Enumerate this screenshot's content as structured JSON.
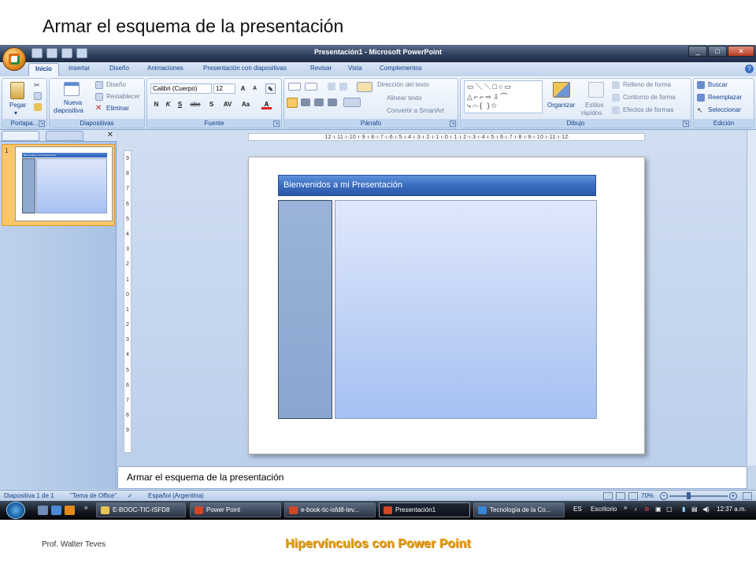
{
  "slide_heading": "Armar el esquema de la presentación",
  "window": {
    "title": "Presentación1 - Microsoft PowerPoint",
    "tabs": [
      "Inicio",
      "Insertar",
      "Diseño",
      "Animaciones",
      "Presentación con diapositivas",
      "Revisar",
      "Vista",
      "Complementos"
    ],
    "active_tab": "Inicio"
  },
  "ribbon": {
    "portapapeles": {
      "label": "Portapa...",
      "pegar": "Pegar"
    },
    "diapositivas": {
      "label": "Diapositivas",
      "nueva": "Nueva",
      "nueva2": "diapositiva",
      "diseno": "Diseño",
      "restablecer": "Restablecer",
      "eliminar": "Eliminar"
    },
    "fuente": {
      "label": "Fuente",
      "font": "Calibri (Cuerpo)",
      "size": "12"
    },
    "parrafo": {
      "label": "Párrafo",
      "direccion": "Dirección del texto",
      "alinear": "Alinear texto",
      "smartart": "Convertir a SmartArt"
    },
    "dibujo": {
      "label": "Dibujo",
      "organizar": "Organizar",
      "estilos": "Estilos",
      "estilos2": "rápidos",
      "relleno": "Relleno de forma",
      "contorno": "Contorno de forma",
      "efectos": "Efectos de formas"
    },
    "edicion": {
      "label": "Edición",
      "buscar": "Buscar",
      "reemplazar": "Reemplazar",
      "seleccionar": "Seleccionar"
    }
  },
  "ruler_h": "·12·ı·11·ı·10·ı·9·ı·8·ı·7·ı·6·ı·5·ı·4·ı·3·ı·2·ı·1·ı·0·ı·1·ı·2·ı·3·ı·4·ı·5·ı·6·ı·7·ı·8·ı·9·ı·10·ı·11·ı·12·",
  "ruler_v": [
    "9",
    "8",
    "7",
    "6",
    "5",
    "4",
    "3",
    "2",
    "1",
    "0",
    "1",
    "2",
    "3",
    "4",
    "5",
    "6",
    "7",
    "8",
    "9"
  ],
  "slide": {
    "number": "1",
    "title": "Bienvenidos a mi Presentación",
    "thumb_title": "Bienvenidos a mi Presentación"
  },
  "notes_text": "Armar el esquema  de la presentación",
  "status": {
    "slide_count": "Diapositiva 1 de 1",
    "theme": "\"Tema de Office\"",
    "language": "Español (Argentina)",
    "zoom": "70%"
  },
  "taskbar": {
    "items": [
      "E-BOOC-TIC-ISFD8",
      "Power Point",
      "e-book-tic-isfd8-tev...",
      "Presentación1",
      "Tecnología de la Co..."
    ],
    "active_index": 3,
    "lang": "ES",
    "desktop": "Escritorio",
    "time": "12:37 a.m."
  },
  "footer": {
    "author": "Prof. Walter Teves",
    "course": "Hipervínculos con Power Point"
  },
  "colors": {
    "accent": "#2a58a7",
    "footer_title": "#e6a11c",
    "ribbon_text": "#15428b"
  }
}
